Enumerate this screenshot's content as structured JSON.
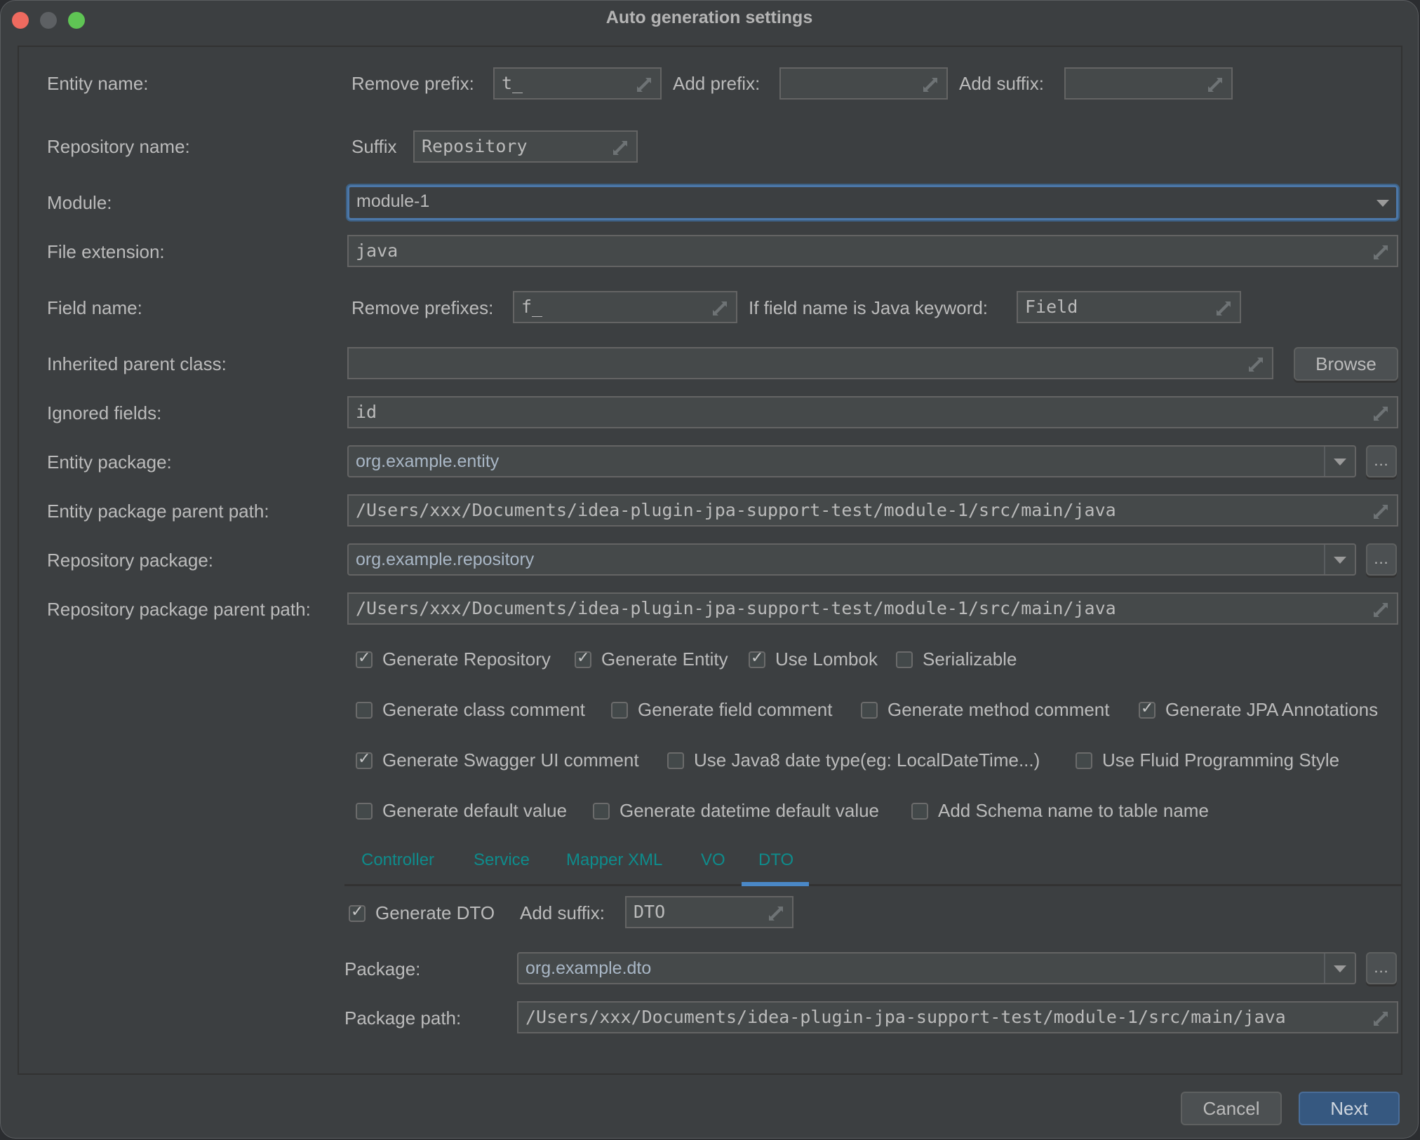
{
  "window": {
    "title": "Auto generation settings",
    "controls": [
      "close",
      "minimize",
      "maximize"
    ]
  },
  "entity_name": {
    "label": "Entity name:",
    "remove_prefix_label": "Remove prefix:",
    "remove_prefix_value": "t_",
    "add_prefix_label": "Add prefix:",
    "add_prefix_value": "",
    "add_suffix_label": "Add suffix:",
    "add_suffix_value": ""
  },
  "repository_name": {
    "label": "Repository name:",
    "suffix_label": "Suffix",
    "suffix_value": "Repository"
  },
  "module": {
    "label": "Module:",
    "value": "module-1"
  },
  "file_extension": {
    "label": "File extension:",
    "value": "java"
  },
  "field_name": {
    "label": "Field name:",
    "remove_prefixes_label": "Remove prefixes:",
    "remove_prefixes_value": "f_",
    "java_keyword_label": "If field name is Java keyword:",
    "java_keyword_value": "Field"
  },
  "inherited_parent_class": {
    "label": "Inherited parent class:",
    "value": "",
    "browse_label": "Browse"
  },
  "ignored_fields": {
    "label": "Ignored fields:",
    "value": "id"
  },
  "entity_package": {
    "label": "Entity package:",
    "value": "org.example.entity",
    "more_label": "..."
  },
  "entity_package_parent_path": {
    "label": "Entity package parent path:",
    "value": "/Users/xxx/Documents/idea-plugin-jpa-support-test/module-1/src/main/java"
  },
  "repository_package": {
    "label": "Repository package:",
    "value": "org.example.repository",
    "more_label": "..."
  },
  "repository_package_parent_path": {
    "label": "Repository package parent path:",
    "value": "/Users/xxx/Documents/idea-plugin-jpa-support-test/module-1/src/main/java"
  },
  "options": {
    "row1": [
      {
        "label": "Generate Repository",
        "checked": true
      },
      {
        "label": "Generate Entity",
        "checked": true
      },
      {
        "label": "Use Lombok",
        "checked": true
      },
      {
        "label": "Serializable",
        "checked": false
      }
    ],
    "row2": [
      {
        "label": "Generate class comment",
        "checked": false
      },
      {
        "label": "Generate field comment",
        "checked": false
      },
      {
        "label": "Generate method comment",
        "checked": false
      },
      {
        "label": "Generate JPA Annotations",
        "checked": true
      }
    ],
    "row3": [
      {
        "label": "Generate Swagger UI comment",
        "checked": true
      },
      {
        "label": "Use Java8 date type(eg: LocalDateTime...)",
        "checked": false
      },
      {
        "label": "Use Fluid Programming Style",
        "checked": false
      }
    ],
    "row4": [
      {
        "label": "Generate default value",
        "checked": false
      },
      {
        "label": "Generate datetime default value",
        "checked": false
      },
      {
        "label": "Add Schema name to table name",
        "checked": false
      }
    ]
  },
  "tabs": {
    "items": [
      "Controller",
      "Service",
      "Mapper XML",
      "VO",
      "DTO"
    ],
    "active": "DTO",
    "color": "#0e8c8c",
    "indicator_color": "#4a88c7"
  },
  "dto": {
    "generate_label": "Generate DTO",
    "generate_checked": true,
    "add_suffix_label": "Add suffix:",
    "add_suffix_value": "DTO",
    "package_label": "Package:",
    "package_value": "org.example.dto",
    "more_label": "...",
    "package_path_label": "Package path:",
    "package_path_value": "/Users/xxx/Documents/idea-plugin-jpa-support-test/module-1/src/main/java"
  },
  "footer": {
    "cancel_label": "Cancel",
    "next_label": "Next"
  },
  "colors": {
    "background": "#3c3f41",
    "field": "#45494a",
    "focus": "#4c77a8",
    "primary_button": "#365880",
    "package_text": "#a9b7c6"
  }
}
